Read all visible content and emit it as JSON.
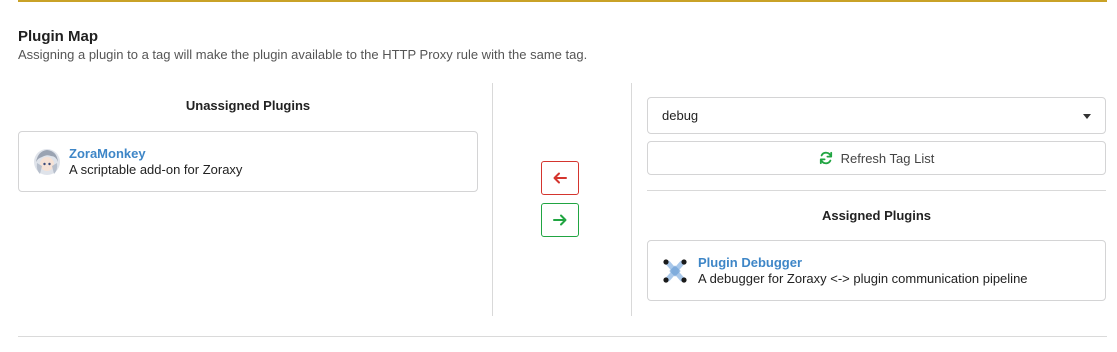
{
  "header": {
    "title": "Plugin Map",
    "description": "Assigning a plugin to a tag will make the plugin available to the HTTP Proxy rule with the same tag."
  },
  "unassigned": {
    "heading": "Unassigned Plugins",
    "plugins": [
      {
        "name": "ZoraMonkey",
        "description": "A scriptable add-on for Zoraxy",
        "icon": "avatar-icon"
      }
    ]
  },
  "actions": {
    "unassign_icon": "arrow-left-icon",
    "assign_icon": "arrow-right-icon"
  },
  "tag_selector": {
    "selected": "debug"
  },
  "refresh": {
    "label": "Refresh Tag List",
    "icon": "refresh-icon"
  },
  "assigned": {
    "heading": "Assigned Plugins",
    "plugins": [
      {
        "name": "Plugin Debugger",
        "description": "A debugger for Zoraxy <-> plugin communication pipeline",
        "icon": "debugger-icon"
      }
    ]
  },
  "colors": {
    "accent_top": "#c9a227",
    "link": "#3e86c7",
    "danger": "#d4352e",
    "success": "#21a542"
  }
}
